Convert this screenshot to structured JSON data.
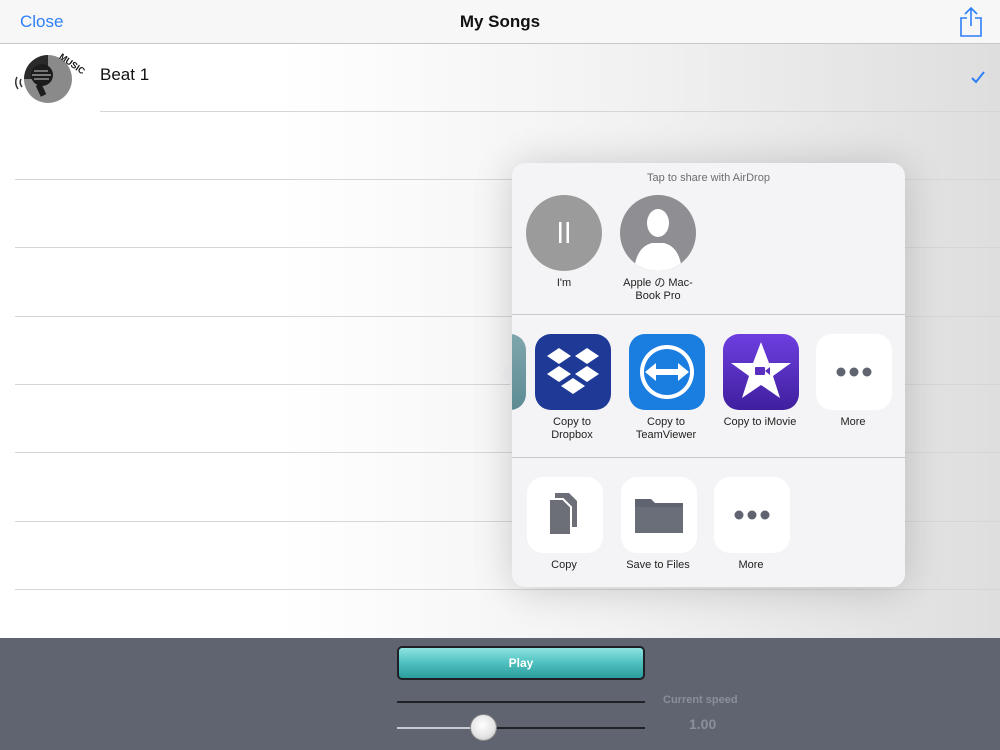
{
  "navbar": {
    "close_label": "Close",
    "title": "My Songs"
  },
  "songs": [
    {
      "title": "Beat 1",
      "art_text": "MUSIC",
      "selected": true
    }
  ],
  "share_sheet": {
    "header": "Tap to share with AirDrop",
    "airdrop_targets": [
      {
        "label": "I'm",
        "icon": "pause-icon"
      },
      {
        "label": "Apple の Mac-\nBook Pro",
        "icon": "person-silhouette-icon"
      }
    ],
    "apps": [
      {
        "label": "Copy to\nDropbox",
        "icon": "dropbox-icon",
        "color": "#1f3a96"
      },
      {
        "label": "Copy to\nTeamViewer",
        "icon": "teamviewer-icon",
        "color": "#1a7de0"
      },
      {
        "label": "Copy to iMovie",
        "icon": "imovie-star-icon",
        "color": "#5a2fc0"
      },
      {
        "label": "More",
        "icon": "more-dots-icon"
      }
    ],
    "actions": [
      {
        "label": "Copy",
        "icon": "copy-documents-icon"
      },
      {
        "label": "Save to Files",
        "icon": "folder-icon"
      },
      {
        "label": "More",
        "icon": "more-dots-icon"
      }
    ]
  },
  "player": {
    "play_label": "Play",
    "speed_label": "Current speed",
    "speed_value": "1.00",
    "speed_slider_fraction": 0.35
  },
  "colors": {
    "accent": "#2d7ff9",
    "play_button": "#53c4c3",
    "toolbar": "#5f6470"
  }
}
